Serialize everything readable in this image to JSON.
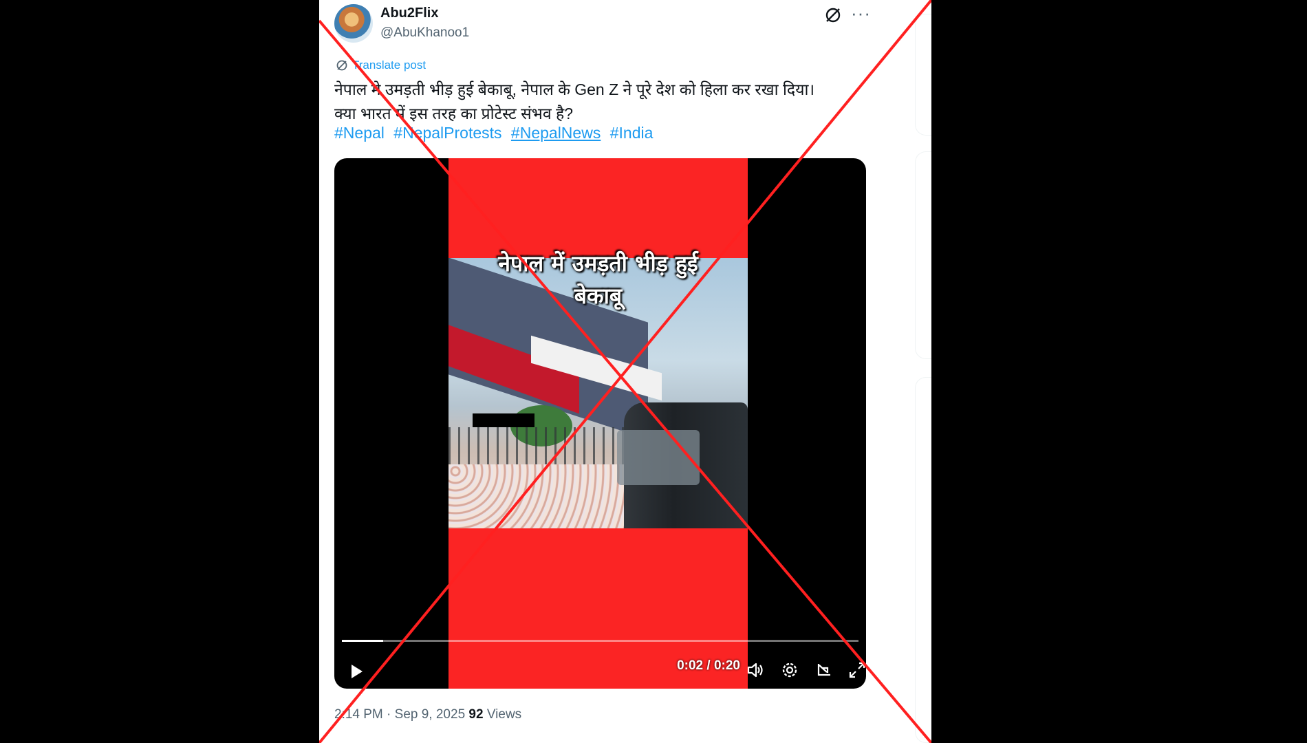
{
  "user": {
    "display_name": "Abu2Flix",
    "handle": "@AbuKhanoo1"
  },
  "post": {
    "translate_label": "Translate post",
    "text_line1": "नेपाल मे उमड़ती भीड़ हुई बेकाबू, नेपाल के Gen Z ने पूरे देश को हिला कर रखा दिया।",
    "text_line2": "क्या भारत में इस तरह का प्रोटेस्ट संभव है?",
    "hashtags": [
      "#Nepal",
      "#NepalProtests",
      "#NepalNews",
      "#India"
    ]
  },
  "video": {
    "caption_line1": "नेपाल में उमड़ती भीड़ हुई",
    "caption_line2": "बेकाबू",
    "time": "0:02 / 0:20",
    "progress": 0.08
  },
  "meta": {
    "time": "2:14 PM",
    "separator": " · ",
    "date": "Sep 9, 2025",
    "views_count": "92",
    "views_label": " Views"
  },
  "icons": [
    "grok-icon",
    "more-icon",
    "translate-icon",
    "play-icon",
    "volume-icon",
    "settings-icon",
    "pip-icon",
    "fullscreen-icon"
  ],
  "colors": {
    "link": "#1d9bf0",
    "text": "#0f1419",
    "secondary": "#536471",
    "video_bg": "#fb2424",
    "x_mark": "#ff2020"
  }
}
